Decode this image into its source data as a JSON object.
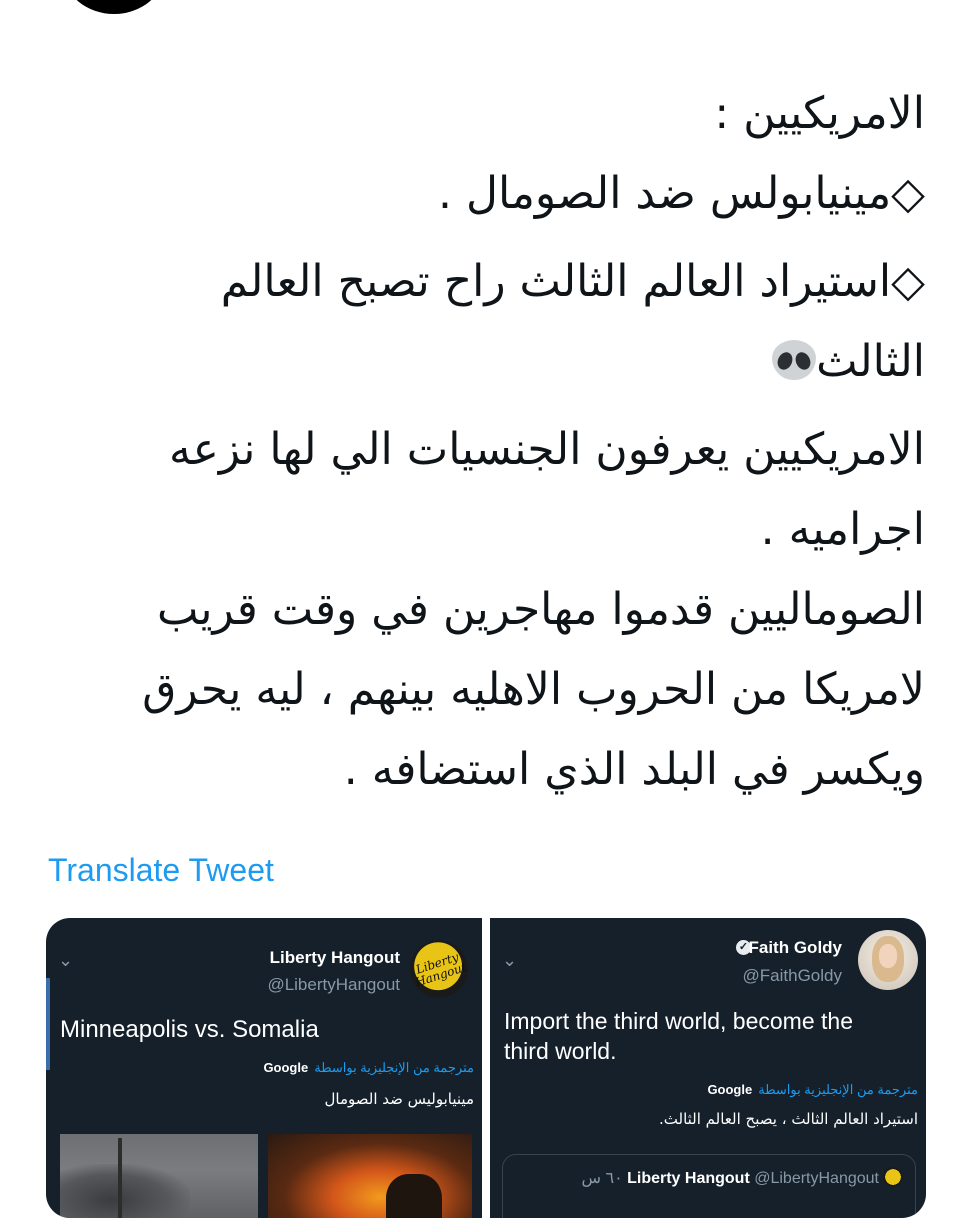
{
  "tweet": {
    "lines": [
      "الامريكيين :",
      "◇مينيابولس ضد الصومال .",
      "◇استيراد العالم الثالث راح تصبح العالم",
      "الثالث",
      "الامريكيين يعرفون الجنسيات الي لها نزعه",
      "اجراميه .",
      "الصوماليين قدموا مهاجرين في وقت قريب",
      "لامريكا من الحروب الاهليه بينهم ، ليه يحرق",
      "ويكسر في البلد الذي استضافه ."
    ],
    "translate_link": "Translate Tweet"
  },
  "media": {
    "left": {
      "name": "Liberty Hangout",
      "handle": "@LibertyHangout",
      "logo_text": "Liberty Hangout",
      "text": "Minneapolis vs. Somalia",
      "translated_by": "مترجمة من الإنجليزية بواسطة",
      "google": "Google",
      "translation": "مينيابوليس ضد الصومال"
    },
    "right": {
      "name": "Faith Goldy",
      "handle": "@FaithGoldy",
      "text_line1": "Import the third world, become the",
      "text_line2": "third world.",
      "translated_by": "مترجمة من الإنجليزية بواسطة",
      "google": "Google",
      "translation": "استيراد العالم الثالث ، يصبح العالم الثالث.",
      "quote_name": "Liberty Hangout",
      "quote_handle": "@LibertyHangout",
      "quote_time": "٦٠ س"
    }
  },
  "icons": {
    "bullet": "diamond-outline",
    "alien": "alien-emoji",
    "verified": "verified-badge",
    "chevron": "chevron-down"
  }
}
